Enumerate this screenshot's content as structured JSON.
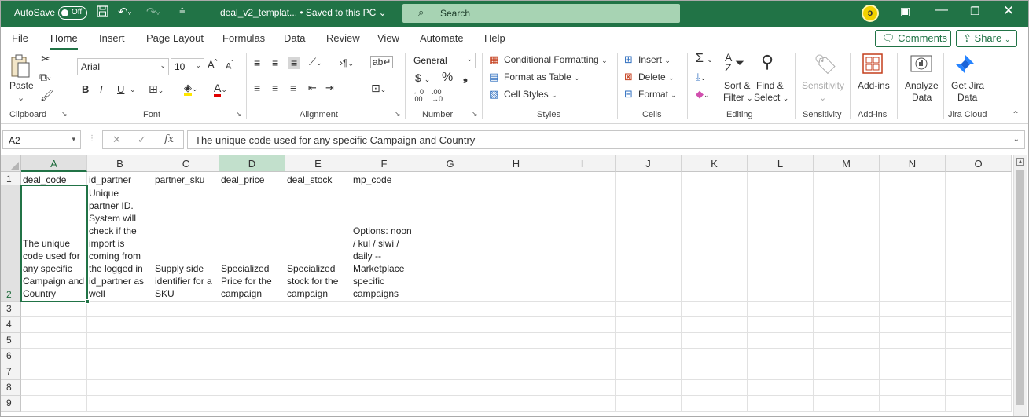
{
  "titlebar": {
    "autosave_label": "AutoSave",
    "autosave_state": "Off",
    "document_title": "deal_v2_templat... • Saved to this PC",
    "search_label": "Search",
    "colors": {
      "titlebar": "#217346",
      "search": "#a7d3b3"
    }
  },
  "tabs": [
    "File",
    "Home",
    "Insert",
    "Page Layout",
    "Formulas",
    "Data",
    "Review",
    "View",
    "Automate",
    "Help"
  ],
  "active_tab": "Home",
  "actions": {
    "comments": "Comments",
    "share": "Share"
  },
  "ribbon": {
    "clipboard": {
      "paste": "Paste",
      "label": "Clipboard"
    },
    "font": {
      "name": "Arial",
      "size": "10",
      "label": "Font",
      "bold": "B",
      "italic": "I",
      "underline": "U"
    },
    "alignment": {
      "label": "Alignment"
    },
    "number": {
      "format": "General",
      "label": "Number"
    },
    "styles": {
      "conditional": "Conditional Formatting",
      "table": "Format as Table",
      "cell_styles": "Cell Styles",
      "label": "Styles"
    },
    "cells": {
      "insert": "Insert",
      "delete": "Delete",
      "format": "Format",
      "label": "Cells"
    },
    "editing": {
      "sort1": "Sort &",
      "sort2": "Filter",
      "find1": "Find &",
      "find2": "Select",
      "label": "Editing"
    },
    "sensitivity": {
      "button": "Sensitivity",
      "label": "Sensitivity"
    },
    "addins": {
      "button": "Add-ins",
      "label": "Add-ins"
    },
    "analyze": {
      "line1": "Analyze",
      "line2": "Data"
    },
    "jira": {
      "line1": "Get Jira",
      "line2": "Data",
      "label": "Jira Cloud"
    }
  },
  "formula_bar": {
    "name_box": "A2",
    "fx": "fx",
    "formula": "The unique code used for any specific Campaign and Country"
  },
  "sheet": {
    "columns": [
      "A",
      "B",
      "C",
      "D",
      "E",
      "F",
      "G",
      "H",
      "I",
      "J",
      "K",
      "L",
      "M",
      "N",
      "O"
    ],
    "rows": [
      "1",
      "2",
      "3",
      "4",
      "5",
      "6",
      "7",
      "8",
      "9"
    ],
    "headers": [
      "deal_code",
      "id_partner",
      "partner_sku",
      "deal_price",
      "deal_stock",
      "mp_code"
    ],
    "descriptions": [
      [
        "The unique",
        "code used for",
        "any specific",
        "Campaign and",
        "Country"
      ],
      [
        "Unique",
        "partner ID.",
        "System will",
        "check if the",
        "import is",
        "coming from",
        "the logged in",
        "id_partner as",
        "well"
      ],
      [
        "Supply side",
        "identifier for a",
        "SKU"
      ],
      [
        "Specialized",
        "Price for the",
        "campaign"
      ],
      [
        "Specialized",
        "stock for the",
        "campaign"
      ],
      [
        "Options: noon",
        "/ kul / siwi /",
        "daily --",
        "Marketplace",
        "specific",
        "campaigns"
      ]
    ]
  }
}
